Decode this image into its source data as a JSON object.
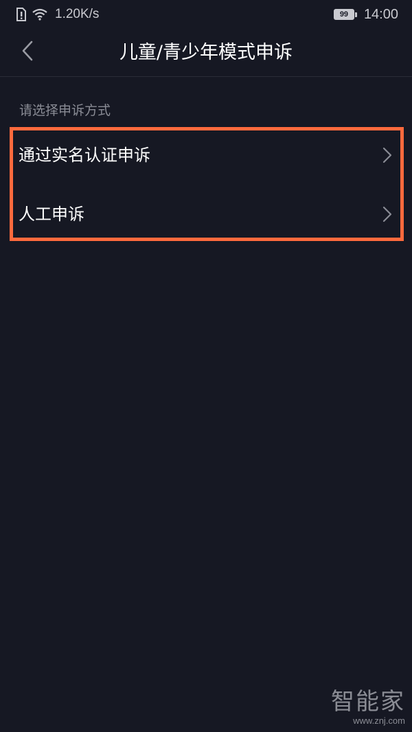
{
  "status_bar": {
    "net_speed": "1.20K/s",
    "battery_level": "99",
    "time": "14:00",
    "icons": [
      "sim-alert-icon",
      "wifi-icon",
      "battery-icon"
    ]
  },
  "header": {
    "title": "儿童/青少年模式申诉",
    "back_icon": "chevron-left-icon"
  },
  "main": {
    "section_label": "请选择申诉方式",
    "options": [
      {
        "label": "通过实名认证申诉",
        "icon": "chevron-right-icon"
      },
      {
        "label": "人工申诉",
        "icon": "chevron-right-icon"
      }
    ],
    "highlight_color": "#ff6a3d"
  },
  "watermark": {
    "logo": "智能家",
    "url": "www.znj.com"
  },
  "colors": {
    "background": "#161823",
    "text_primary": "#ffffff",
    "text_secondary": "#8a8c95"
  }
}
